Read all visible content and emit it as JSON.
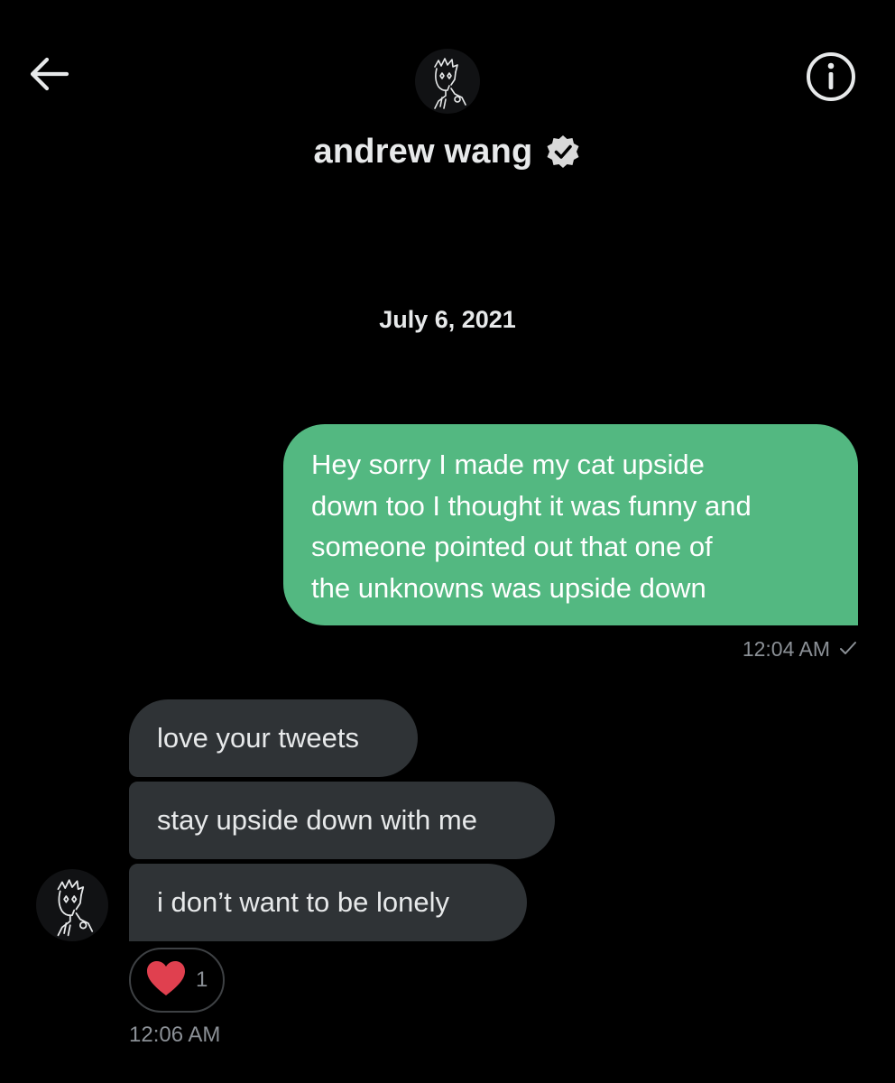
{
  "header": {
    "contact_name": "andrew wang",
    "back_icon": "arrow-left-icon",
    "info_icon": "info-circle-icon",
    "verified_icon": "verified-badge-icon"
  },
  "date_separator": "July 6, 2021",
  "sent_message": {
    "lines": [
      "Hey sorry I made my cat upside",
      "down too I thought it was funny and",
      "someone pointed out that one of",
      "the unknowns was upside down"
    ],
    "time": "12:04 AM",
    "status_icon": "checkmark-icon"
  },
  "received_messages": [
    {
      "text": "love your tweets"
    },
    {
      "text": "stay upside down with me"
    },
    {
      "text": "i don’t want to be lonely"
    }
  ],
  "reaction": {
    "emoji_icon": "heart-icon",
    "count": "1"
  },
  "received_time": "12:06 AM",
  "colors": {
    "background": "#000000",
    "sent_bubble": "#53b881",
    "received_bubble": "#2f3336",
    "primary_text": "#e7e9ea",
    "secondary_text": "#8b9096",
    "heart": "#e0404f"
  }
}
